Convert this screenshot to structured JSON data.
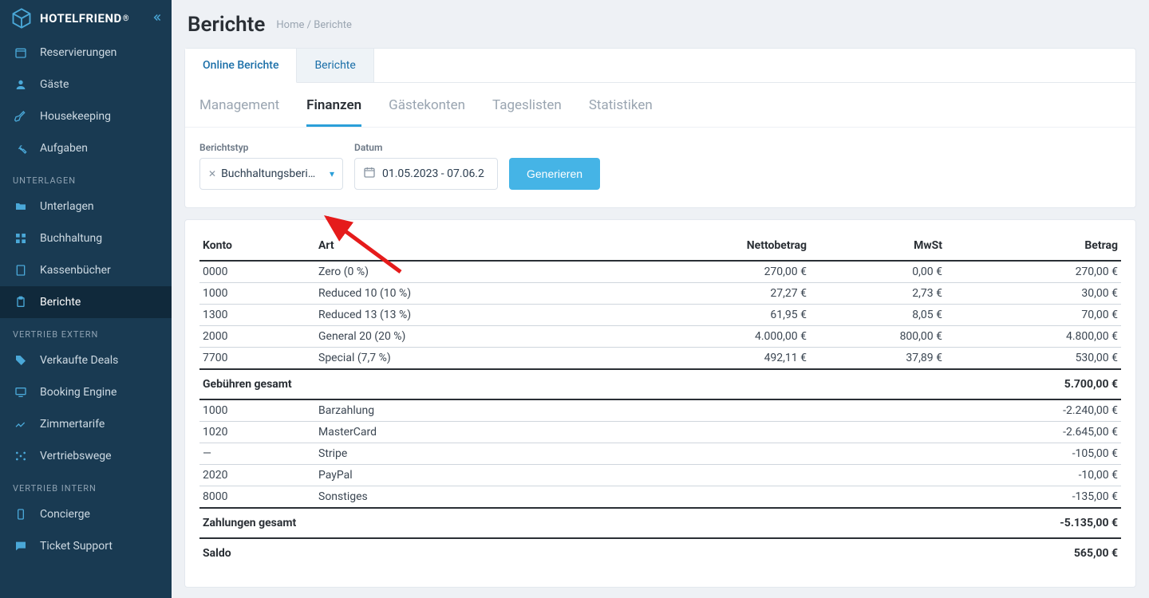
{
  "brand": {
    "name": "HOTELFRIEND",
    "reg": "®"
  },
  "sidebar": {
    "items": [
      "Reservierungen",
      "Gäste",
      "Housekeeping",
      "Aufgaben"
    ],
    "section_unterlagen": "UNTERLAGEN",
    "unterlagen_items": [
      "Unterlagen",
      "Buchhaltung",
      "Kassenbücher",
      "Berichte"
    ],
    "section_vertrieb_extern": "VERTRIEB EXTERN",
    "vertrieb_extern_items": [
      "Verkaufte Deals",
      "Booking Engine",
      "Zimmertarife",
      "Vertriebswege"
    ],
    "section_vertrieb_intern": "VERTRIEB INTERN",
    "vertrieb_intern_items": [
      "Concierge",
      "Ticket Support"
    ]
  },
  "page": {
    "title": "Berichte",
    "breadcrumb_home": "Home",
    "breadcrumb_sep": " / ",
    "breadcrumb_current": "Berichte"
  },
  "top_tabs": {
    "online": "Online Berichte",
    "berichte": "Berichte"
  },
  "sub_tabs": [
    "Management",
    "Finanzen",
    "Gästekonten",
    "Tageslisten",
    "Statistiken"
  ],
  "filters": {
    "type_label": "Berichtstyp",
    "type_value": "Buchhaltungsberi…",
    "date_label": "Datum",
    "date_value": "01.05.2023 - 07.06.2",
    "generate": "Generieren"
  },
  "table": {
    "head": {
      "konto": "Konto",
      "art": "Art",
      "netto": "Nettobetrag",
      "mwst": "MwSt",
      "betrag": "Betrag"
    },
    "fees": [
      {
        "konto": "0000",
        "art": "Zero (0 %)",
        "netto": "270,00 €",
        "mwst": "0,00 €",
        "betrag": "270,00 €"
      },
      {
        "konto": "1000",
        "art": "Reduced 10 (10 %)",
        "netto": "27,27 €",
        "mwst": "2,73 €",
        "betrag": "30,00 €"
      },
      {
        "konto": "1300",
        "art": "Reduced 13 (13 %)",
        "netto": "61,95 €",
        "mwst": "8,05 €",
        "betrag": "70,00 €"
      },
      {
        "konto": "2000",
        "art": "General 20 (20 %)",
        "netto": "4.000,00 €",
        "mwst": "800,00 €",
        "betrag": "4.800,00 €"
      },
      {
        "konto": "7700",
        "art": "Special (7,7 %)",
        "netto": "492,11 €",
        "mwst": "37,89 €",
        "betrag": "530,00 €"
      }
    ],
    "fees_total_label": "Gebühren gesamt",
    "fees_total_value": "5.700,00 €",
    "payments": [
      {
        "konto": "1000",
        "art": "Barzahlung",
        "betrag": "-2.240,00 €"
      },
      {
        "konto": "1020",
        "art": "MasterCard",
        "betrag": "-2.645,00 €"
      },
      {
        "konto": "—",
        "art": "Stripe",
        "betrag": "-105,00 €"
      },
      {
        "konto": "2020",
        "art": "PayPal",
        "betrag": "-10,00 €"
      },
      {
        "konto": "8000",
        "art": "Sonstiges",
        "betrag": "-135,00 €"
      }
    ],
    "payments_total_label": "Zahlungen gesamt",
    "payments_total_value": "-5.135,00 €",
    "saldo_label": "Saldo",
    "saldo_value": "565,00 €"
  }
}
